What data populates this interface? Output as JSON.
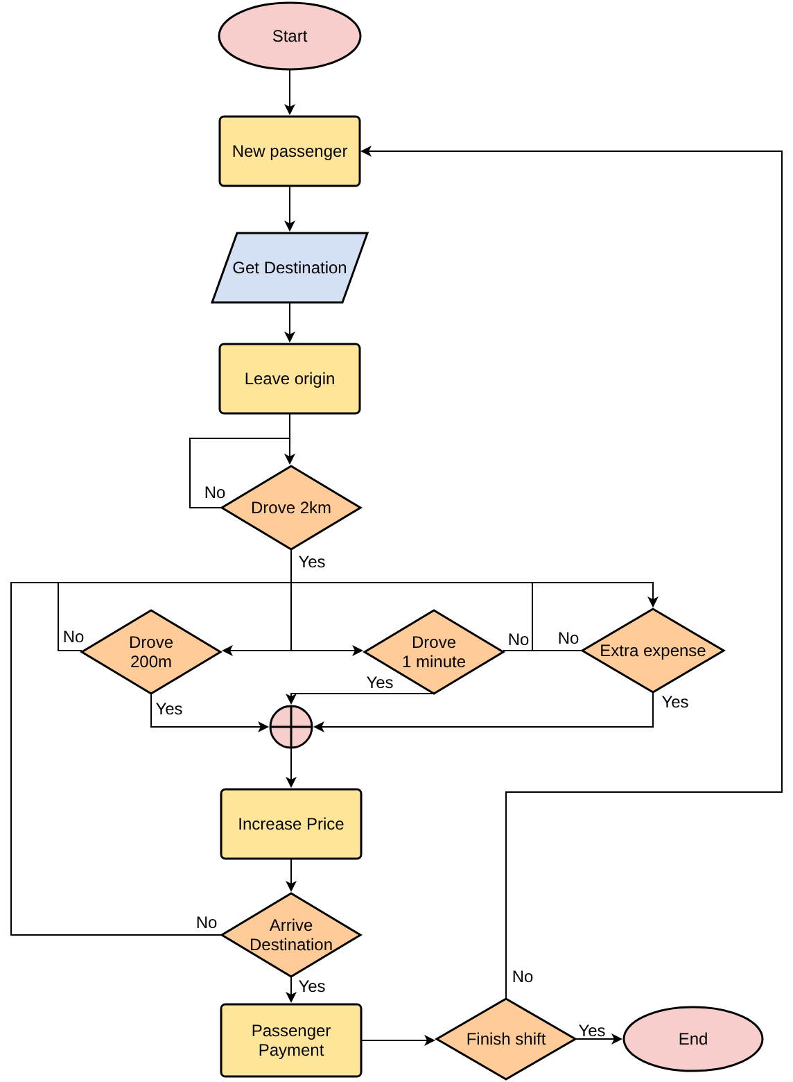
{
  "nodes": [
    {
      "kind": "terminal",
      "label": "Start"
    },
    {
      "kind": "process",
      "label": "New passenger"
    },
    {
      "kind": "io",
      "label": "Get Destination"
    },
    {
      "kind": "process",
      "label": "Leave origin"
    },
    {
      "kind": "decision",
      "label": "Drove 2km"
    },
    {
      "kind": "decision",
      "label": "Drove\n200m"
    },
    {
      "kind": "decision",
      "label": "Drove\n1 minute"
    },
    {
      "kind": "decision",
      "label": "Extra expense"
    },
    {
      "kind": "junction"
    },
    {
      "kind": "process",
      "label": "Increase Price"
    },
    {
      "kind": "decision",
      "label": "Arrive\nDestination"
    },
    {
      "kind": "process",
      "label": "Passenger\nPayment"
    },
    {
      "kind": "decision",
      "label": "Finish shift"
    },
    {
      "kind": "terminal",
      "label": "End"
    }
  ],
  "edge_labels": [
    "No",
    "Yes",
    "No",
    "No",
    "No",
    "Yes",
    "Yes",
    "Yes",
    "No",
    "Yes",
    "Yes",
    "No"
  ]
}
